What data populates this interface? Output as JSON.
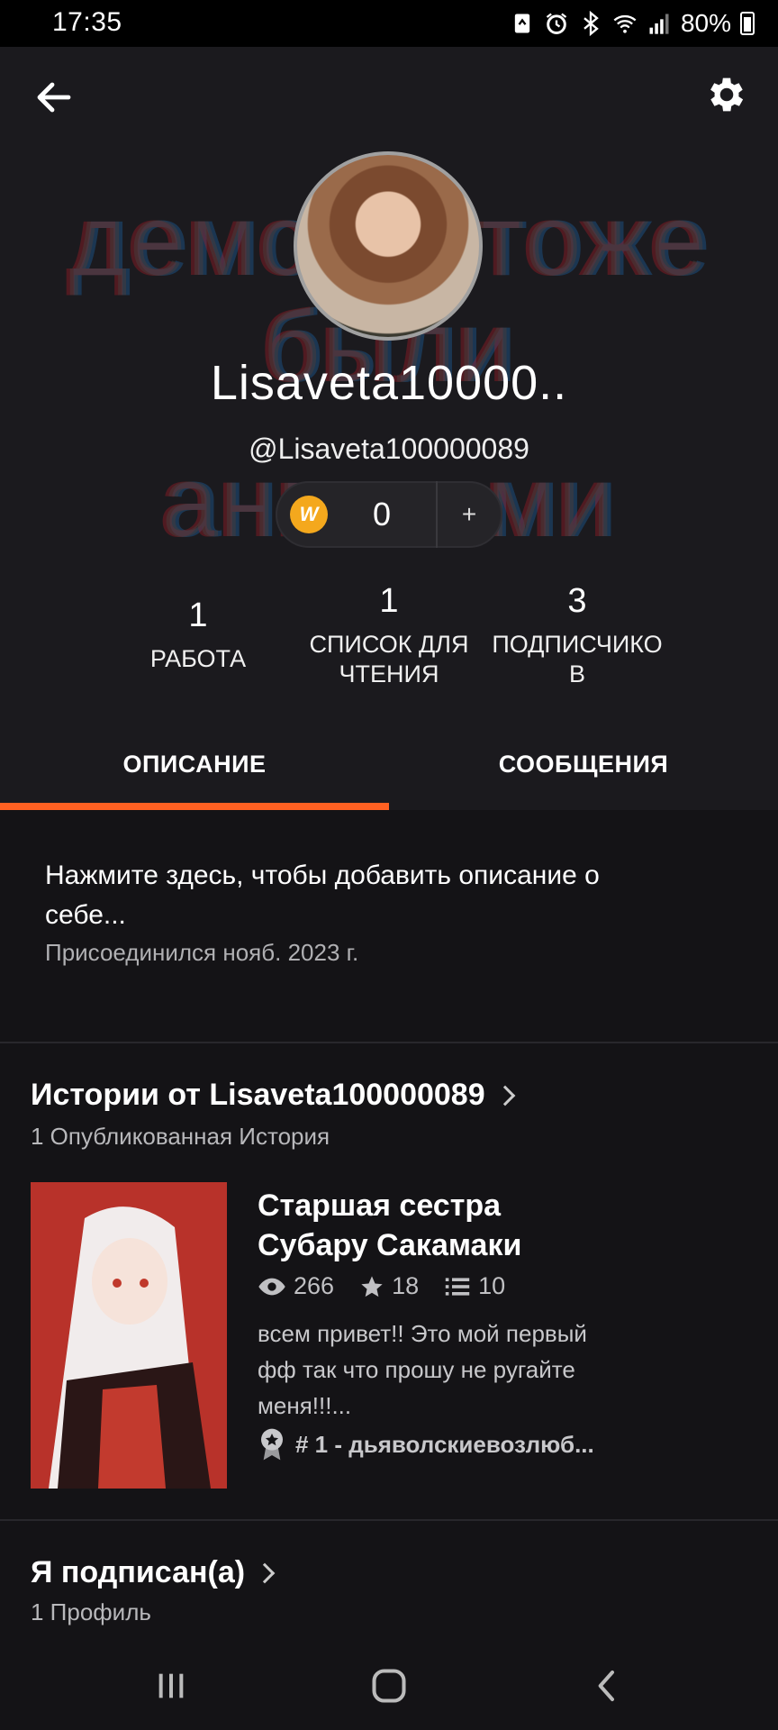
{
  "status_bar": {
    "time": "17:35",
    "battery": "80%",
    "icons": [
      "recycle-icon",
      "alarm-icon",
      "bluetooth-icon",
      "wifi-icon",
      "signal-icon",
      "battery-icon"
    ]
  },
  "profile": {
    "background_text": [
      "демоны тоже",
      "были",
      "ангелами"
    ],
    "display_name": "Lisaveta10000..",
    "handle": "@Lisaveta100000089",
    "coins": {
      "value": "0",
      "add_label": "+",
      "icon_letter": "W"
    }
  },
  "stats": [
    {
      "value": "1",
      "label": "РАБОТА"
    },
    {
      "value": "1",
      "label": "СПИСОК ДЛЯ ЧТЕНИЯ"
    },
    {
      "value": "3",
      "label": "ПОДПИСЧИКОВ"
    }
  ],
  "tabs": [
    {
      "label": "ОПИСАНИЕ",
      "active": true
    },
    {
      "label": "СООБЩЕНИЯ",
      "active": false
    }
  ],
  "description": {
    "prompt": "Нажмите здесь, чтобы добавить описание о себе...",
    "joined": "Присоединился нояб. 2023 г."
  },
  "stories": {
    "title": "Истории от Lisaveta100000089",
    "subtitle": "1 Опубликованная История",
    "items": [
      {
        "title": "Старшая сестра Субару Сакамаки",
        "reads": "266",
        "votes": "18",
        "parts": "10",
        "blurb": "всем привет!! Это мой первый фф так что прошу не ругайте меня!!!...",
        "rank": "# 1 - дьяволскиевозлюб..."
      }
    ]
  },
  "following": {
    "title": "Я подписан(а)",
    "subtitle": "1 Профиль"
  },
  "colors": {
    "accent": "#ff6122",
    "background": "#141316",
    "header": "#1b1a1e",
    "coin": "#f4a81d"
  }
}
